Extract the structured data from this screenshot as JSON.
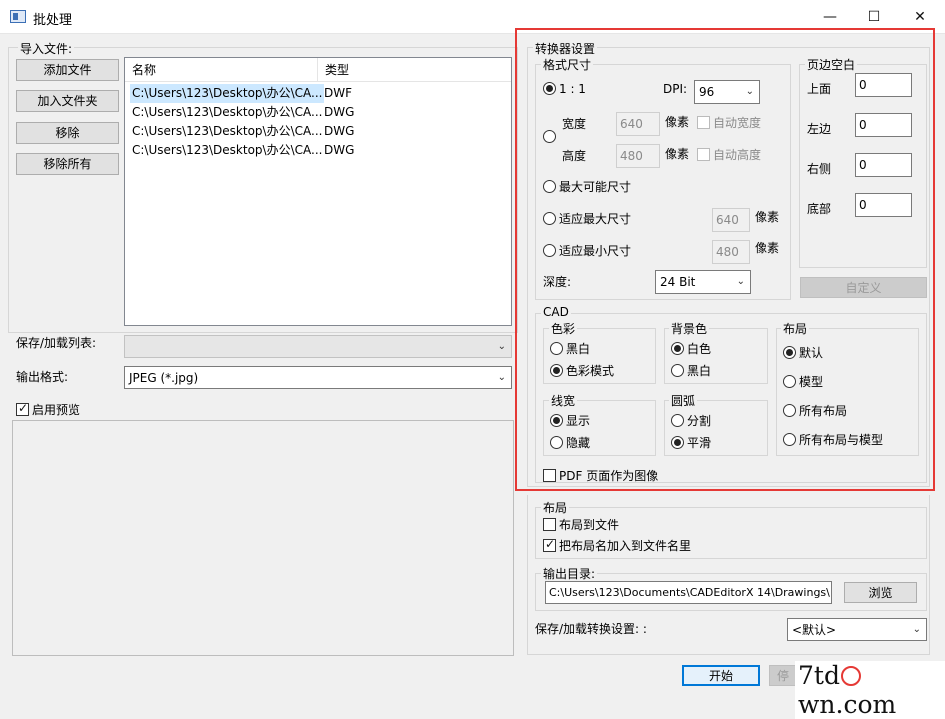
{
  "window": {
    "title": "批处理",
    "minimize": "—",
    "maximize": "☐",
    "close": "✕"
  },
  "import": {
    "legend": "导入文件:",
    "buttons": {
      "add_file": "添加文件",
      "add_folder": "加入文件夹",
      "remove": "移除",
      "remove_all": "移除所有"
    },
    "columns": [
      "名称",
      "类型"
    ],
    "files": [
      {
        "name": "C:\\Users\\123\\Desktop\\办公\\CA...",
        "type": "DWF"
      },
      {
        "name": "C:\\Users\\123\\Desktop\\办公\\CA...",
        "type": "DWG"
      },
      {
        "name": "C:\\Users\\123\\Desktop\\办公\\CA...",
        "type": "DWG"
      },
      {
        "name": "C:\\Users\\123\\Desktop\\办公\\CA...",
        "type": "DWG"
      }
    ]
  },
  "save_load_list": {
    "label": "保存/加载列表:",
    "value": ""
  },
  "output_format": {
    "label": "输出格式:",
    "value": "JPEG (*.jpg)"
  },
  "preview": {
    "label": "启用预览",
    "checked": true
  },
  "converter": {
    "legend": "转换器设置",
    "format_size": {
      "legend": "格式尺寸",
      "one_to_one": "1 : 1",
      "dpi_label": "DPI:",
      "dpi_value": "96",
      "width_label": "宽度",
      "width_value": "640",
      "height_label": "高度",
      "height_value": "480",
      "px": "像素",
      "auto_width": "自动宽度",
      "auto_height": "自动高度",
      "max_possible": "最大可能尺寸",
      "fit_max": "适应最大尺寸",
      "fit_max_value": "640",
      "fit_min": "适应最小尺寸",
      "fit_min_value": "480",
      "depth_label": "深度:",
      "depth_value": "24 Bit"
    },
    "margins": {
      "legend": "页边空白",
      "top_label": "上面",
      "top_value": "0",
      "left_label": "左边",
      "left_value": "0",
      "right_label": "右侧",
      "right_value": "0",
      "bottom_label": "底部",
      "bottom_value": "0",
      "custom_button": "自定义"
    },
    "cad": {
      "legend": "CAD",
      "color": {
        "legend": "色彩",
        "opt1": "黑白",
        "opt2": "色彩模式"
      },
      "background": {
        "legend": "背景色",
        "opt1": "白色",
        "opt2": "黑白"
      },
      "layout": {
        "legend": "布局",
        "opt1": "默认",
        "opt2": "模型",
        "opt3": "所有布局",
        "opt4": "所有布局与模型"
      },
      "linewidth": {
        "legend": "线宽",
        "opt1": "显示",
        "opt2": "隐藏"
      },
      "arc": {
        "legend": "圆弧",
        "opt1": "分割",
        "opt2": "平滑"
      },
      "pdf_as_image": "PDF 页面作为图像"
    }
  },
  "layout_group": {
    "legend": "布局",
    "layout_to_file": "布局到文件",
    "add_layout_name": "把布局名加入到文件名里"
  },
  "output_dir": {
    "legend": "输出目录:",
    "value": "C:\\Users\\123\\Documents\\CADEditorX 14\\Drawings\\",
    "browse": "浏览"
  },
  "save_load_settings": {
    "label": "保存/加载转换设置: :",
    "value": "<默认>"
  },
  "footer": {
    "start": "开始",
    "stop": "停"
  },
  "watermark": {
    "text_a": "7td",
    "text_b": "wn.com"
  },
  "colors": {
    "highlight_frame": "#e53935",
    "selected_row": "#cce8ff",
    "accent": "#0078d7"
  }
}
